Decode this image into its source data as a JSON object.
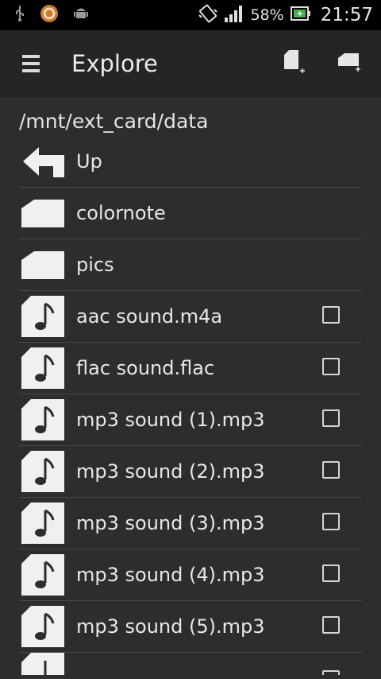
{
  "status_bar": {
    "icons_left": [
      "usb-icon",
      "app-notification-icon",
      "android-icon"
    ],
    "icons_right": [
      "vibrate-icon",
      "signal-icon",
      "battery-charging-icon"
    ],
    "battery": "58%",
    "time": "21:57"
  },
  "action_bar": {
    "title": "Explore",
    "actions": [
      "new-file-icon",
      "new-folder-icon"
    ]
  },
  "path": "/mnt/ext_card/data",
  "items": [
    {
      "label": "Up",
      "type": "up"
    },
    {
      "label": "colornote",
      "type": "folder"
    },
    {
      "label": "pics",
      "type": "folder"
    },
    {
      "label": "aac sound.m4a",
      "type": "audio",
      "checked": false
    },
    {
      "label": "flac sound.flac",
      "type": "audio",
      "checked": false
    },
    {
      "label": "mp3 sound (1).mp3",
      "type": "audio",
      "checked": false
    },
    {
      "label": "mp3 sound (2).mp3",
      "type": "audio",
      "checked": false
    },
    {
      "label": "mp3 sound (3).mp3",
      "type": "audio",
      "checked": false
    },
    {
      "label": "mp3 sound (4).mp3",
      "type": "audio",
      "checked": false
    },
    {
      "label": "mp3 sound (5).mp3",
      "type": "audio",
      "checked": false
    }
  ],
  "colors": {
    "background": "#2d2d2d",
    "action_bar": "#252525",
    "status_bar": "#000000",
    "icon_fill": "#f0f0f0",
    "text": "#e8e8e8"
  }
}
